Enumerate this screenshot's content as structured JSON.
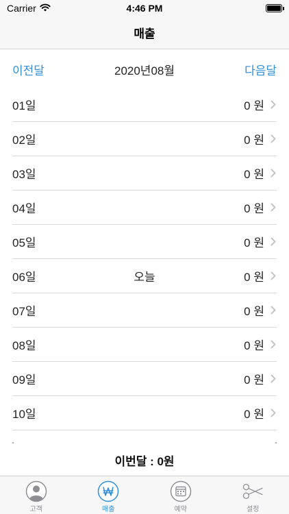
{
  "status_bar": {
    "carrier": "Carrier",
    "time": "4:46 PM"
  },
  "nav": {
    "title": "매출"
  },
  "month": {
    "prev_label": "이전달",
    "current": "2020년08월",
    "next_label": "다음달"
  },
  "days": [
    {
      "label": "01일",
      "note": "",
      "amount": "0 원"
    },
    {
      "label": "02일",
      "note": "",
      "amount": "0 원"
    },
    {
      "label": "03일",
      "note": "",
      "amount": "0 원"
    },
    {
      "label": "04일",
      "note": "",
      "amount": "0 원"
    },
    {
      "label": "05일",
      "note": "",
      "amount": "0 원"
    },
    {
      "label": "06일",
      "note": "오늘",
      "amount": "0 원"
    },
    {
      "label": "07일",
      "note": "",
      "amount": "0 원"
    },
    {
      "label": "08일",
      "note": "",
      "amount": "0 원"
    },
    {
      "label": "09일",
      "note": "",
      "amount": "0 원"
    },
    {
      "label": "10일",
      "note": "",
      "amount": "0 원"
    }
  ],
  "total": {
    "text": "이번달 : 0원"
  },
  "tabs": [
    {
      "label": "고객",
      "icon": "person-icon",
      "active": false
    },
    {
      "label": "매출",
      "icon": "won-icon",
      "active": true
    },
    {
      "label": "예약",
      "icon": "calendar-icon",
      "active": false
    },
    {
      "label": "설정",
      "icon": "scissors-icon",
      "active": false
    }
  ],
  "colors": {
    "accent": "#2f8fd8",
    "separator": "#d9d9d9",
    "inactive_tab": "#8e8e93"
  }
}
